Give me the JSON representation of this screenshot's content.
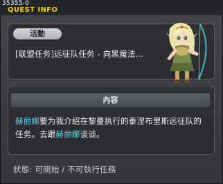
{
  "window": {
    "quest_id": "35355-0",
    "title": "QUEST INFO"
  },
  "activity": {
    "badge": "活動",
    "quest_name": "[联盟任务]远征队任务 - 向黑魔法..."
  },
  "npc": {
    "icon": "elf-archer-npc-icon"
  },
  "content": {
    "header": "內容",
    "npc_name_1": "赫丽娜",
    "text_1": "要为我介绍在黎曼执行的泰涅布里斯远征队的任务。去跟",
    "npc_name_2": "赫丽娜",
    "text_2": "谈谈。"
  },
  "status": {
    "text": "狀態: 可開始 / 不可執行任務"
  },
  "colors": {
    "title": "#f1d200",
    "highlight": "#5fd6ea"
  }
}
